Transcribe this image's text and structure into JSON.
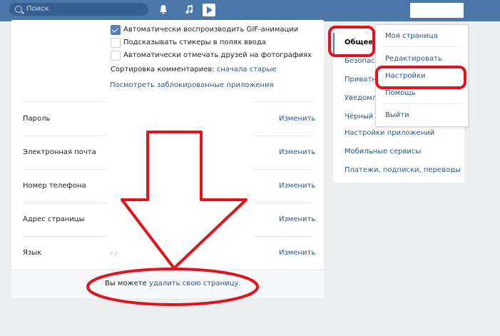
{
  "topbar": {
    "search_placeholder": "Поиск",
    "icons": [
      "search-icon",
      "bell-icon",
      "music-icon",
      "play-icon"
    ]
  },
  "settings": {
    "checkboxes": [
      {
        "label": "Автоматически воспроизводить GIF-анимации",
        "checked": true
      },
      {
        "label": "Подсказывать стикеры в полях ввода",
        "checked": false
      },
      {
        "label": "Автоматически отмечать друзей на фотографиях",
        "checked": false
      }
    ],
    "comment_sort_label": "Сортировка комментариев:",
    "comment_sort_value": "сначала старые",
    "blocked_apps_link": "Посмотреть заблокированные приложения",
    "rows": [
      {
        "label": "Пароль",
        "value": "",
        "action": "Изменить"
      },
      {
        "label": "Электронная почта",
        "value": "",
        "action": "Изменить"
      },
      {
        "label": "Номер телефона",
        "value": "",
        "action": "Изменить"
      },
      {
        "label": "Адрес страницы",
        "value": "",
        "action": "Изменить"
      },
      {
        "label": "Язык",
        "value": "Ру",
        "action": "Изменить"
      }
    ],
    "delete_prefix": "Вы можете",
    "delete_link": "удалить свою страницу."
  },
  "right_menu": {
    "items": [
      "Общее",
      "Безопасн",
      "Приватн",
      "Уведомл",
      "Чёрный с",
      "Настройки приложений",
      "Мобильные сервисы",
      "Платежи, подписки, переводы"
    ],
    "active": "Общее"
  },
  "dropdown": {
    "items": [
      "Моя страница",
      "Редактировать",
      "Настройки",
      "Помощь",
      "Выйти"
    ]
  },
  "annotation_color": "#e0141e",
  "colors": {
    "header": "#4a76a8",
    "link": "#2a5885",
    "accent": "#5181b8"
  }
}
